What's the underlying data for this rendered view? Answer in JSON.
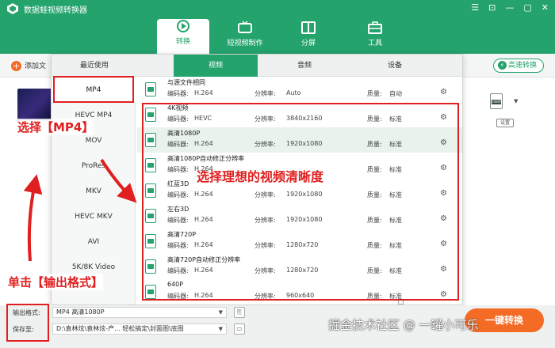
{
  "app": {
    "title": "数据蛙视频转换器",
    "colors": {
      "primary": "#24a36d",
      "accent": "#f36b24",
      "annotation": "#e02020"
    }
  },
  "window_controls": {
    "icons": [
      "menu-icon",
      "cart-icon",
      "minimize-icon",
      "restore-icon",
      "close-icon"
    ]
  },
  "nav": {
    "items": [
      {
        "label": "转换",
        "icon": "convert-icon",
        "active": true
      },
      {
        "label": "短视频制作",
        "icon": "tv-icon",
        "active": false
      },
      {
        "label": "分屏",
        "icon": "split-screen-icon",
        "active": false
      },
      {
        "label": "工具",
        "icon": "toolbox-icon",
        "active": false
      }
    ]
  },
  "toolbar": {
    "add_file": "添加文",
    "fast_convert": "高速转换"
  },
  "format_panel": {
    "tabs": [
      {
        "label": "最近使用",
        "active": false
      },
      {
        "label": "视频",
        "active": true
      },
      {
        "label": "音频",
        "active": false
      },
      {
        "label": "设备",
        "active": false
      }
    ],
    "formats": [
      "MP4",
      "HEVC MP4",
      "MOV",
      "ProRes",
      "MKV",
      "HEVC MKV",
      "AVI",
      "5K/8K Video"
    ],
    "selected_format": "MP4",
    "presets": [
      {
        "name": "与源文件相同",
        "codec": "H.264",
        "resolution": "Auto",
        "quality": "自动"
      },
      {
        "name": "4K视频",
        "codec": "HEVC",
        "resolution": "3840x2160",
        "quality": "标准"
      },
      {
        "name": "高清1080P",
        "codec": "H.264",
        "resolution": "1920x1080",
        "quality": "标准"
      },
      {
        "name": "高清1080P自动修正分辨率",
        "codec": "H.264",
        "resolution": "",
        "quality": "标准"
      },
      {
        "name": "红蓝3D",
        "codec": "H.264",
        "resolution": "1920x1080",
        "quality": "标准"
      },
      {
        "name": "左右3D",
        "codec": "H.264",
        "resolution": "1920x1080",
        "quality": "标准"
      },
      {
        "name": "高清720P",
        "codec": "H.264",
        "resolution": "1280x720",
        "quality": "标准"
      },
      {
        "name": "高清720P自动修正分辨率",
        "codec": "H.264",
        "resolution": "1280x720",
        "quality": "标准"
      },
      {
        "name": "640P",
        "codec": "H.264",
        "resolution": "960x640",
        "quality": "标准"
      }
    ],
    "labels": {
      "codec": "编码器:",
      "resolution": "分辨率:",
      "quality": "质量:"
    },
    "highlighted_preset": "高清1080P"
  },
  "output": {
    "format_label": "输出格式:",
    "format_value": "MP4 高清1080P",
    "save_label": "保存至:",
    "save_path": "D:\\袁林炫\\袁林炫-产...   轻松搞定\\封面图\\底图"
  },
  "right_format_badge": {
    "badge": "1080P",
    "settings": "设置"
  },
  "convert_button": "一键转换",
  "annotations": {
    "select_mp4": "选择【MP4】",
    "select_quality": "选择理想的视频清晰度",
    "click_output": "单击【输出格式】"
  },
  "watermark": "掘金技术社区 @ 一罐小可乐"
}
